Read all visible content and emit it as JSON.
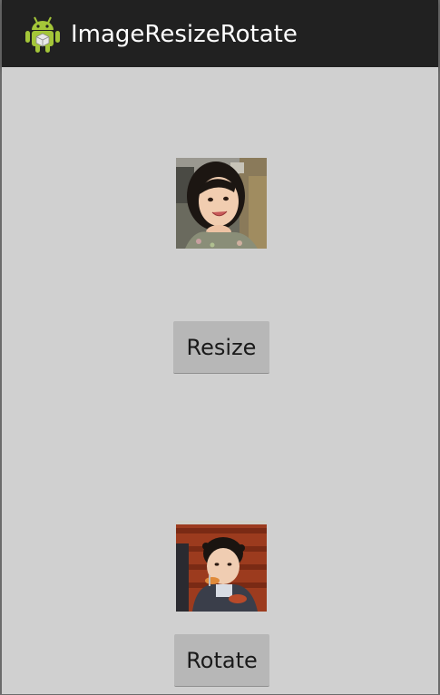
{
  "app": {
    "title": "ImageResizeRotate",
    "icon": "android-robot-icon"
  },
  "images": [
    {
      "name": "resized-photo",
      "description_icon": "photo-thumbnail"
    },
    {
      "name": "rotated-photo",
      "description_icon": "photo-thumbnail"
    }
  ],
  "buttons": {
    "resize_label": "Resize",
    "rotate_label": "Rotate"
  },
  "colors": {
    "action_bar": "#212121",
    "background": "#d0d0d0",
    "button": "#b7b7b7",
    "android_green": "#a4c639"
  }
}
